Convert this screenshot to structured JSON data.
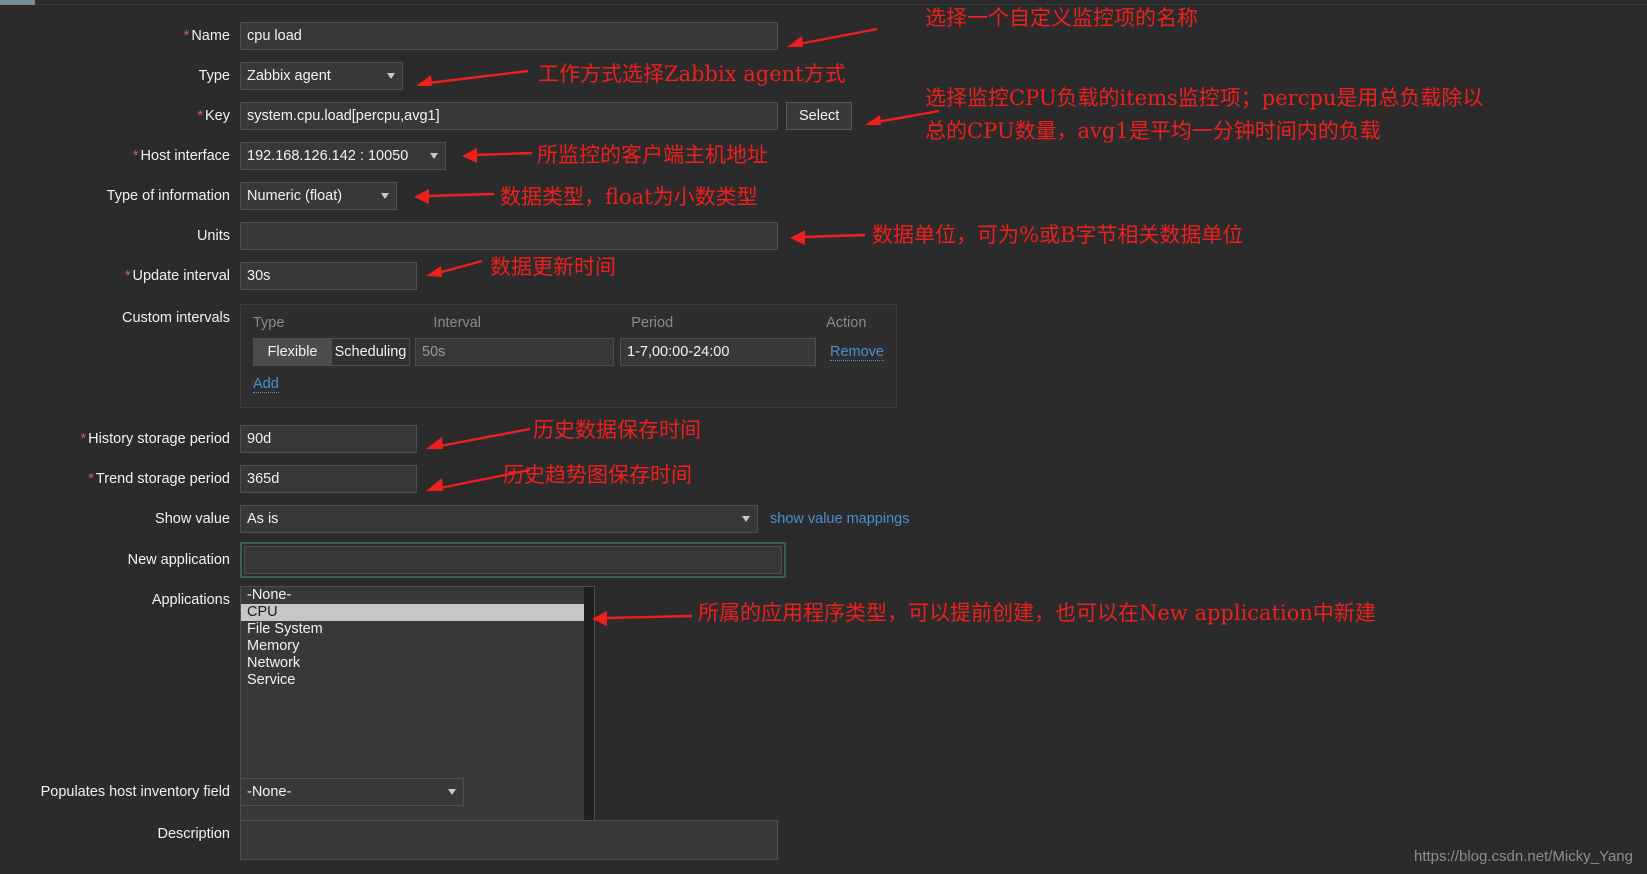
{
  "window": {
    "watermark": "https://blog.csdn.net/Micky_Yang"
  },
  "form": {
    "name": {
      "label": "Name",
      "required": true,
      "value": "cpu load"
    },
    "type": {
      "label": "Type",
      "required": false,
      "value": "Zabbix agent"
    },
    "key": {
      "label": "Key",
      "required": true,
      "value": "system.cpu.load[percpu,avg1]",
      "select_button": "Select"
    },
    "host_interface": {
      "label": "Host interface",
      "required": true,
      "value": "192.168.126.142 : 10050"
    },
    "type_of_information": {
      "label": "Type of information",
      "required": false,
      "value": "Numeric (float)"
    },
    "units": {
      "label": "Units",
      "required": false,
      "value": ""
    },
    "update_interval": {
      "label": "Update interval",
      "required": true,
      "value": "30s"
    },
    "custom_intervals": {
      "label": "Custom intervals",
      "columns": [
        "Type",
        "Interval",
        "Period",
        "Action"
      ],
      "rows": [
        {
          "type_flexible": "Flexible",
          "type_scheduling": "Scheduling",
          "type_selected": "Flexible",
          "interval": "50s",
          "period": "1-7,00:00-24:00",
          "action": "Remove"
        }
      ],
      "add_label": "Add"
    },
    "history_storage_period": {
      "label": "History storage period",
      "required": true,
      "value": "90d"
    },
    "trend_storage_period": {
      "label": "Trend storage period",
      "required": true,
      "value": "365d"
    },
    "show_value": {
      "label": "Show value",
      "required": false,
      "value": "As is",
      "link": "show value mappings"
    },
    "new_application": {
      "label": "New application",
      "required": false,
      "value": "",
      "focused": true
    },
    "applications": {
      "label": "Applications",
      "options": [
        "-None-",
        "CPU",
        "File System",
        "Memory",
        "Network",
        "Service"
      ],
      "selected": "CPU"
    },
    "populates_host_inventory_field": {
      "label": "Populates host inventory field",
      "required": false,
      "value": "-None-"
    },
    "description": {
      "label": "Description",
      "value": ""
    }
  },
  "annotations": [
    {
      "id": "name",
      "text": "选择一个自定义监控项的名称"
    },
    {
      "id": "type",
      "text": "工作方式选择Zabbix agent方式"
    },
    {
      "id": "key_line1",
      "text": "选择监控CPU负载的items监控项；percpu是用总负载除以"
    },
    {
      "id": "key_line2",
      "text": "总的CPU数量，avg1是平均一分钟时间内的负载"
    },
    {
      "id": "host_interface",
      "text": "所监控的客户端主机地址"
    },
    {
      "id": "type_of_information",
      "text": "数据类型，float为小数类型"
    },
    {
      "id": "units",
      "text": "数据单位，可为%或B字节相关数据单位"
    },
    {
      "id": "update_interval",
      "text": "数据更新时间"
    },
    {
      "id": "history",
      "text": "历史数据保存时间"
    },
    {
      "id": "trend",
      "text": "历史趋势图保存时间"
    },
    {
      "id": "applications",
      "text": "所属的应用程序类型，可以提前创建，也可以在New application中新建"
    }
  ],
  "colors": {
    "background": "#2b2b2b",
    "field_background": "#383838",
    "annotation_red": "#ef1f1f",
    "link_blue": "#4c8fd0",
    "tab_marker": "#768d99",
    "selected_option": "#c6c6c6"
  }
}
